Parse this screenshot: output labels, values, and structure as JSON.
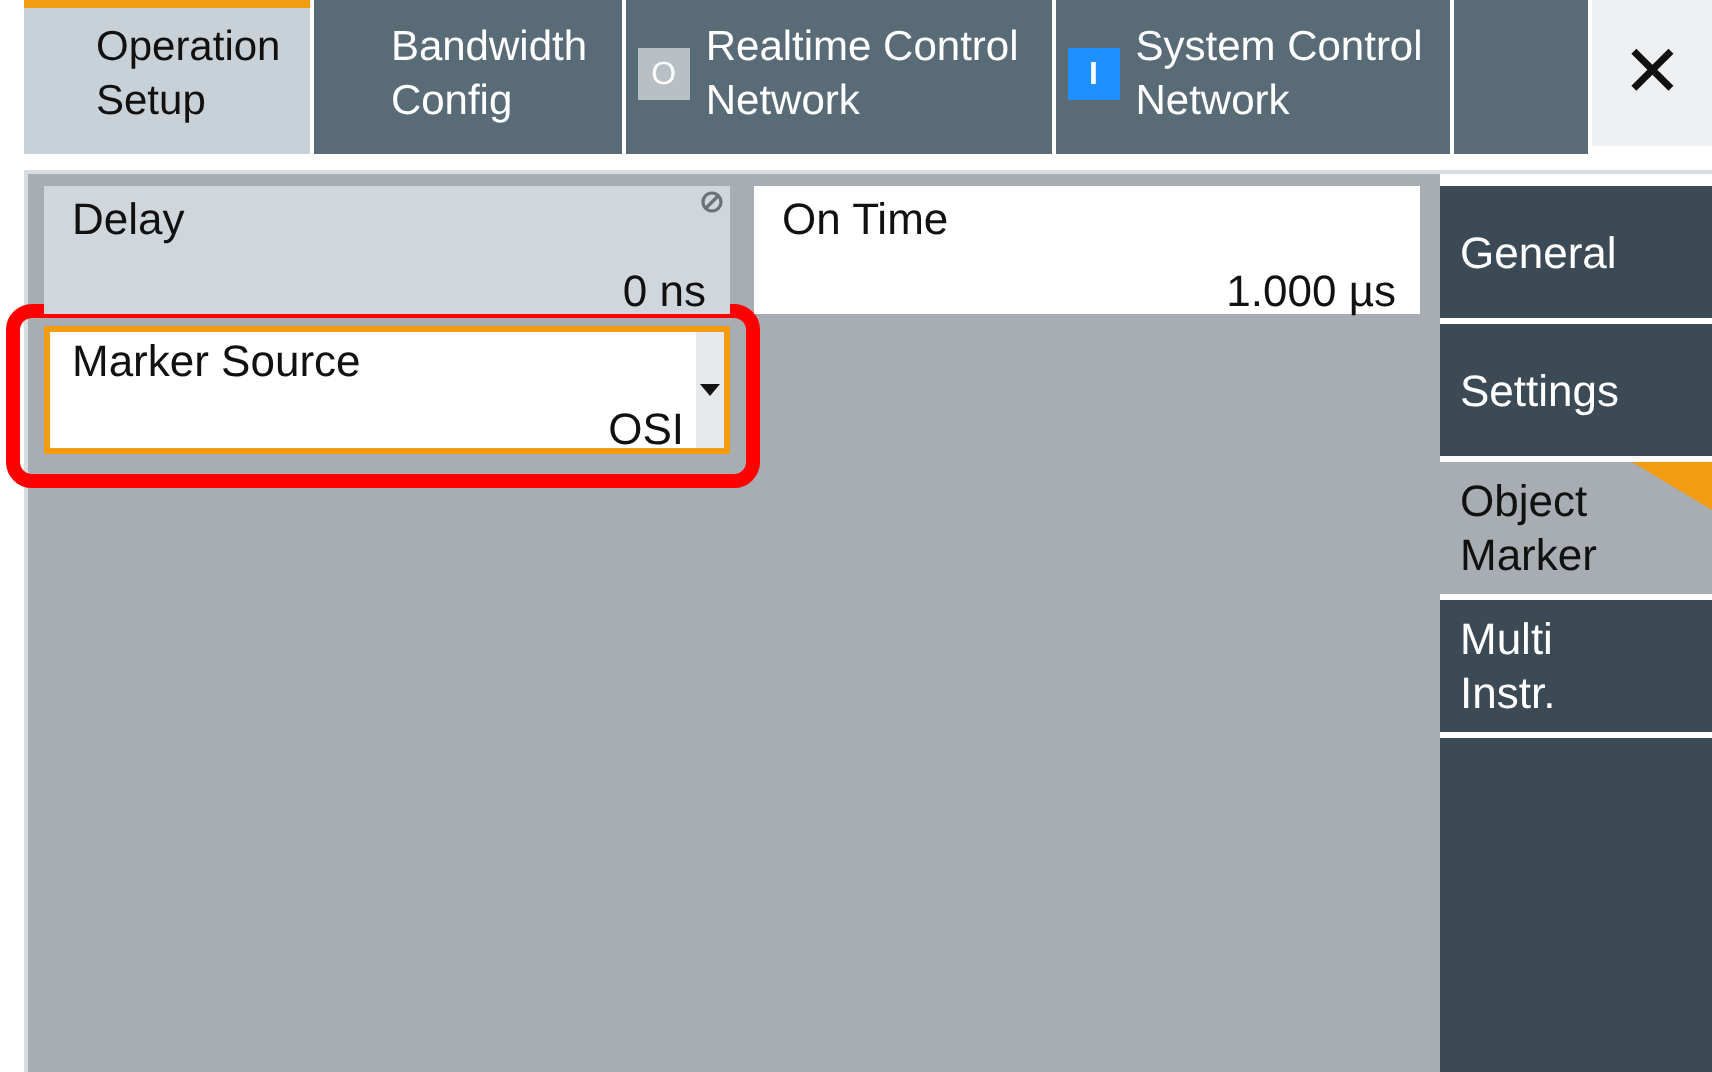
{
  "tabs": [
    {
      "label": "Operation Setup",
      "selected": true
    },
    {
      "label": "Bandwidth Config",
      "selected": false
    },
    {
      "label": "Realtime Control Network",
      "selected": false,
      "indicator": {
        "text": "O",
        "on": false
      }
    },
    {
      "label": "System Control Network",
      "selected": false,
      "indicator": {
        "text": "I",
        "on": true
      }
    }
  ],
  "close_button": {
    "text": "✕"
  },
  "fields": [
    {
      "label": "Delay",
      "value": "0 ns",
      "kind": "value",
      "disabled": true,
      "focused": false,
      "highlighted": false
    },
    {
      "label": "On Time",
      "value": "1.000 µs",
      "kind": "value",
      "disabled": false,
      "focused": false,
      "highlighted": false
    },
    {
      "label": "Marker Source",
      "value": "OSI",
      "kind": "dropdown",
      "disabled": false,
      "focused": true,
      "highlighted": true
    }
  ],
  "side_tabs": [
    {
      "label": "General",
      "selected": false
    },
    {
      "label": "Settings",
      "selected": false
    },
    {
      "label": "Object Marker",
      "selected": true
    },
    {
      "label": "Multi Instr.",
      "selected": false
    }
  ]
}
